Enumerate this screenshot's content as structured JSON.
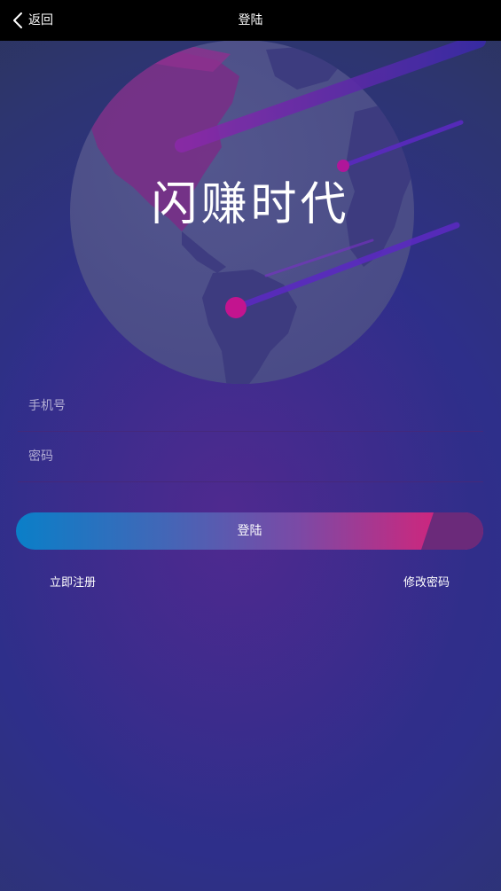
{
  "header": {
    "back_label": "返回",
    "title": "登陆"
  },
  "hero": {
    "logo_text": "闪赚时代"
  },
  "form": {
    "phone_placeholder": "手机号",
    "password_placeholder": "密码",
    "phone_value": "",
    "password_value": "",
    "submit_label": "登陆"
  },
  "links": {
    "register_label": "立即注册",
    "change_password_label": "修改密码"
  },
  "colors": {
    "accent_blue": "#0a7fc8",
    "accent_pink": "#e01a78",
    "background": "#2e2f8a"
  }
}
